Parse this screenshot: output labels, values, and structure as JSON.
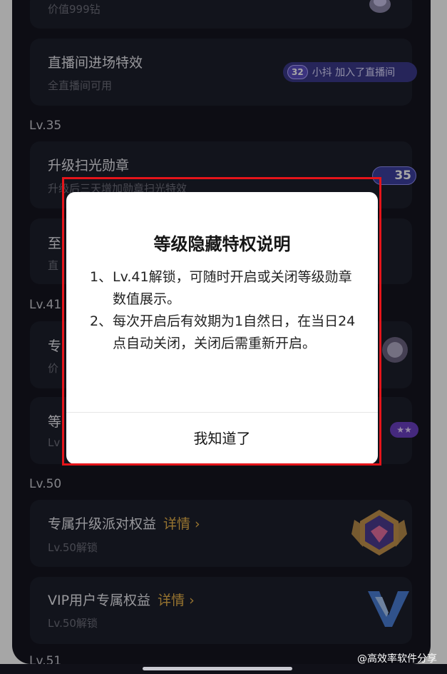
{
  "list": {
    "top_card": {
      "subtitle": "价值999钻"
    },
    "entry_card": {
      "title": "直播间进场特效",
      "subtitle": "全直播间可用",
      "preview_level": "32",
      "preview_text": "小抖 加入了直播间"
    },
    "level_35": "Lv.35",
    "scan_card": {
      "title": "升级扫光勋章",
      "subtitle": "升级后三天增加勋章扫光特效",
      "badge_level": "35"
    },
    "hidden_card": {
      "title_fragment": "至",
      "subtitle_fragment": "直"
    },
    "level_41": "Lv.41",
    "exclusive_card": {
      "title_fragment": "专",
      "subtitle_fragment": "价"
    },
    "level_card": {
      "title_fragment": "等",
      "subtitle_fragment": "Lv"
    },
    "level_50": "Lv.50",
    "party_card": {
      "title": "专属升级派对权益",
      "detail": "详情 ›",
      "subtitle": "Lv.50解锁"
    },
    "vip_card": {
      "title": "VIP用户专属权益",
      "detail": "详情 ›",
      "subtitle": "Lv.50解锁"
    },
    "level_51": "Lv.51"
  },
  "modal": {
    "title": "等级隐藏特权说明",
    "rules": [
      {
        "num": "1、",
        "text": "Lv.41解锁，可随时开启或关闭等级勋章数值展示。"
      },
      {
        "num": "2、",
        "text": "每次开启后有效期为1自然日，在当日24点自动关闭，关闭后需重新开启。"
      }
    ],
    "confirm": "我知道了"
  },
  "watermark": "@高效率软件分享"
}
